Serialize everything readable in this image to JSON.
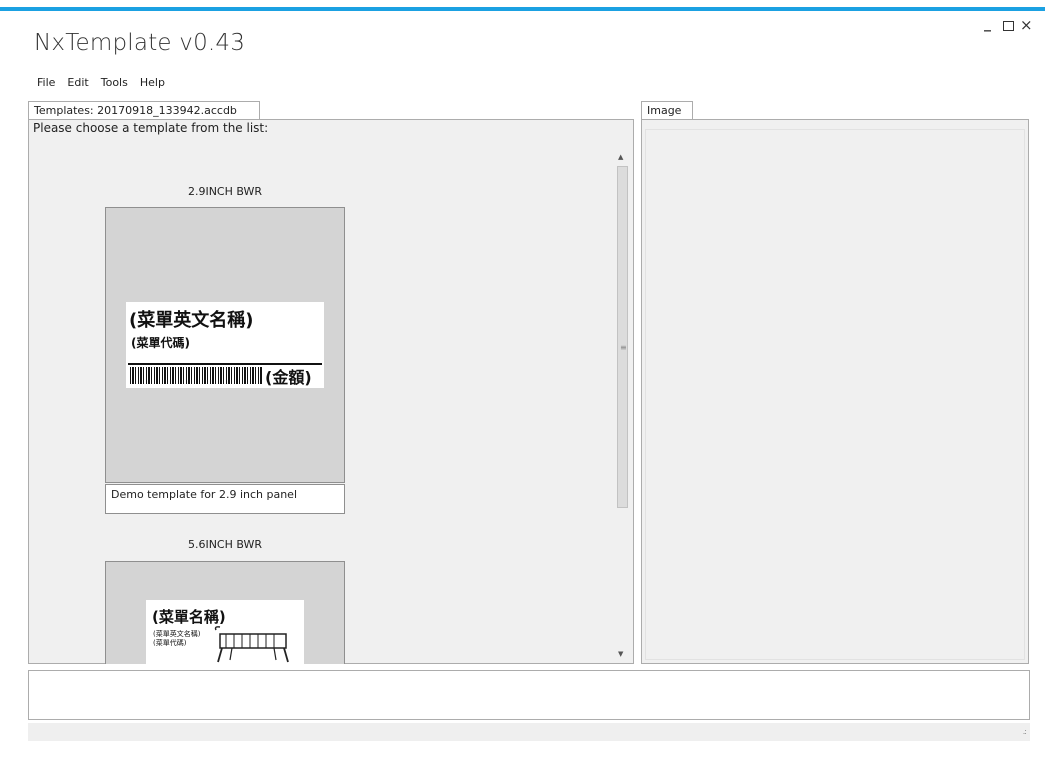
{
  "window": {
    "title": "NxTemplate v0.43",
    "controls": {
      "minimize": "_",
      "close": "×"
    }
  },
  "menu": [
    "File",
    "Edit",
    "Tools",
    "Help"
  ],
  "left_panel": {
    "tab_label": "Templates: 20170918_133942.accdb",
    "prompt": "Please choose a template from the list:",
    "templates": [
      {
        "name": "2.9INCH BWR",
        "description": "Demo template for 2.9 inch panel",
        "preview": {
          "title": "(菜單英文名稱)",
          "code": "(菜單代碼)",
          "amount": "(金額)"
        }
      },
      {
        "name": "5.6INCH BWR",
        "description": "",
        "preview": {
          "title": "(菜單名稱)",
          "line1": "(菜單英文名稱)",
          "line2": "(菜單代碼)"
        }
      }
    ]
  },
  "right_panel": {
    "tab_label": "Image"
  },
  "scrollbar": {
    "grip": "≡"
  },
  "statusbar": {
    "grip": ".:"
  }
}
